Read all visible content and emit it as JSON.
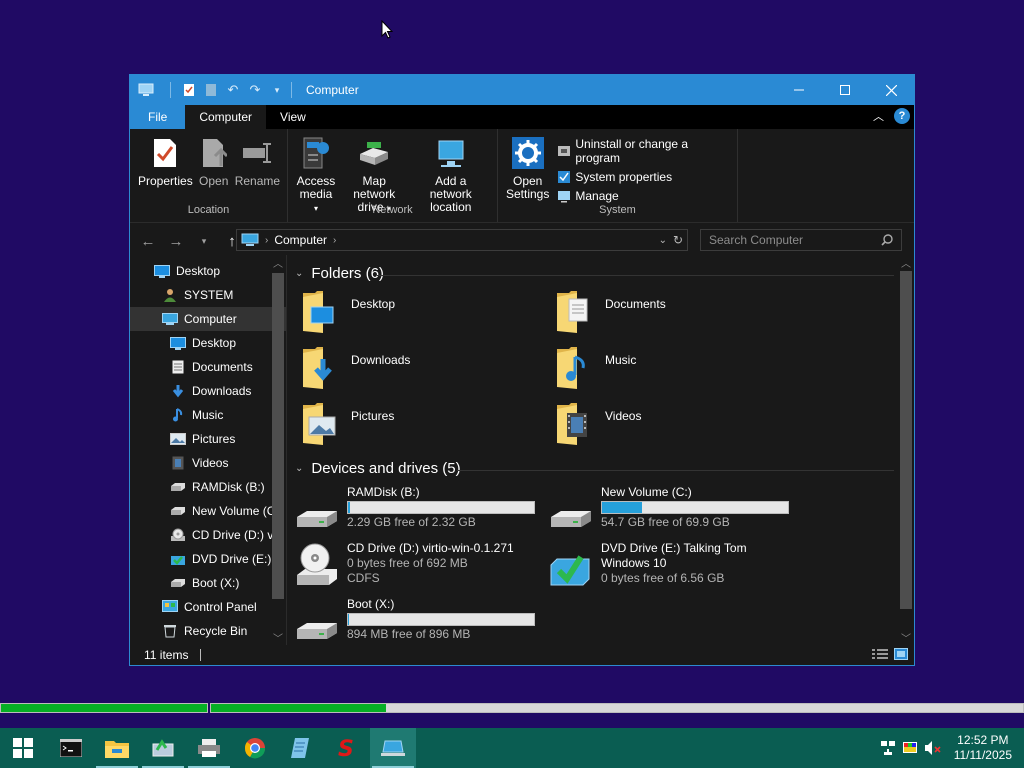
{
  "window": {
    "title": "Computer",
    "tabs": [
      "File",
      "Computer",
      "View"
    ]
  },
  "ribbon": {
    "location": {
      "label": "Location",
      "buttons": [
        "Properties",
        "Open",
        "Rename"
      ]
    },
    "network": {
      "label": "Network",
      "access_media": [
        "Access",
        "media"
      ],
      "map_drive": [
        "Map network",
        "drive"
      ],
      "add_location": [
        "Add a network",
        "location"
      ]
    },
    "system": {
      "label": "System",
      "open_settings": [
        "Open",
        "Settings"
      ],
      "items": [
        "Uninstall or change a program",
        "System properties",
        "Manage"
      ]
    }
  },
  "address": {
    "path": "Computer",
    "search_placeholder": "Search Computer"
  },
  "sidebar": {
    "items": [
      {
        "label": "Desktop",
        "icon": "desktop-icon",
        "indent": 0
      },
      {
        "label": "SYSTEM",
        "icon": "user-icon",
        "indent": 1
      },
      {
        "label": "Computer",
        "icon": "computer-icon",
        "indent": 1,
        "selected": true
      },
      {
        "label": "Desktop",
        "icon": "desktop-icon",
        "indent": 2
      },
      {
        "label": "Documents",
        "icon": "documents-icon",
        "indent": 2
      },
      {
        "label": "Downloads",
        "icon": "downloads-icon",
        "indent": 2
      },
      {
        "label": "Music",
        "icon": "music-icon",
        "indent": 2
      },
      {
        "label": "Pictures",
        "icon": "pictures-icon",
        "indent": 2
      },
      {
        "label": "Videos",
        "icon": "videos-icon",
        "indent": 2
      },
      {
        "label": "RAMDisk (B:)",
        "icon": "drive-icon",
        "indent": 2
      },
      {
        "label": "New Volume (C",
        "icon": "drive-icon",
        "indent": 2
      },
      {
        "label": "CD Drive (D:) v",
        "icon": "cd-drive-icon",
        "indent": 2
      },
      {
        "label": "DVD Drive (E:) T",
        "icon": "dvd-drive-icon",
        "indent": 2
      },
      {
        "label": "Boot (X:)",
        "icon": "drive-icon",
        "indent": 2
      },
      {
        "label": "Control Panel",
        "icon": "control-panel-icon",
        "indent": 1
      },
      {
        "label": "Recycle Bin",
        "icon": "recycle-bin-icon",
        "indent": 1
      }
    ]
  },
  "folders": {
    "heading": "Folders (6)",
    "items": [
      "Desktop",
      "Documents",
      "Downloads",
      "Music",
      "Pictures",
      "Videos"
    ]
  },
  "drives": {
    "heading": "Devices and drives (5)",
    "items": [
      {
        "name": "RAMDisk (B:)",
        "free": "2.29 GB free of 2.32 GB",
        "used_fraction": 0.013,
        "type": "hdd"
      },
      {
        "name": "New Volume (C:)",
        "free": "54.7 GB free of 69.9 GB",
        "used_fraction": 0.217,
        "type": "hdd"
      },
      {
        "name": "CD Drive (D:) virtio-win-0.1.271",
        "free": "0 bytes free of 692 MB",
        "extra": "CDFS",
        "type": "cd"
      },
      {
        "name": "DVD Drive (E:) Talking Tom",
        "name2": "Windows 10",
        "free": "0 bytes free of 6.56 GB",
        "type": "dvd"
      },
      {
        "name": "Boot (X:)",
        "free": "894 MB free of 896 MB",
        "used_fraction": 0.002,
        "type": "hdd"
      }
    ]
  },
  "status": {
    "items": "11 items"
  },
  "progress": {
    "bar1_fraction": 1.0,
    "bar2_fraction": 0.216
  },
  "taskbar": {
    "time": "12:52 PM",
    "date": "11/11/2025"
  },
  "colors": {
    "desktop": "#200a64",
    "accent": "#2a8ad4",
    "taskbar": "#0a5d52",
    "progress": "#06b025",
    "drive_fill": "#26a0da"
  }
}
